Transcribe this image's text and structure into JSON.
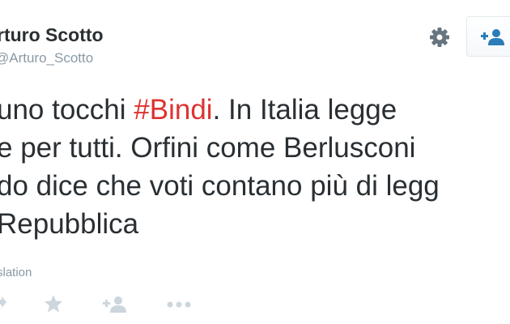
{
  "author": {
    "name": "rturo Scotto",
    "handle": "@Arturo_Scotto"
  },
  "tweet": {
    "line1_pre": "uno tocchi ",
    "line1_hashtag": "#Bindi",
    "line1_post": ". In Italia legge",
    "line2": "e per tutti. Orfini come Berlusconi",
    "line3": "do dice che voti contano più di legg",
    "line4": "Repubblica"
  },
  "translation_link": "slation",
  "icons": {
    "settings": "gear-icon",
    "follow": "add-user-icon",
    "retweet": "retweet-icon",
    "favorite": "star-icon",
    "follow_small": "add-user-icon",
    "more": "more-dots-icon"
  },
  "colors": {
    "hashtag": "#dd3330",
    "text": "#292f33",
    "muted": "#8899a6",
    "icon_blue": "#2b7bb9",
    "icon_gray": "#ccd6dd"
  }
}
